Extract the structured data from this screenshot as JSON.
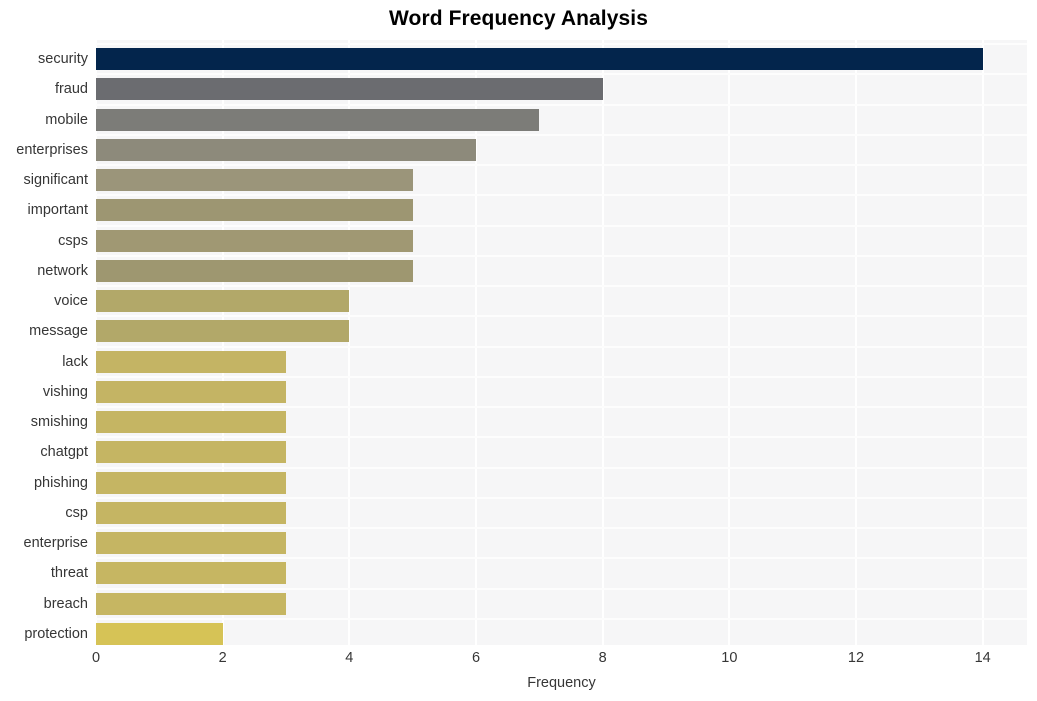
{
  "chart_data": {
    "type": "bar",
    "orientation": "horizontal",
    "title": "Word Frequency Analysis",
    "xlabel": "Frequency",
    "ylabel": "",
    "xlim": [
      0,
      14.7
    ],
    "xticks": [
      0,
      2,
      4,
      6,
      8,
      10,
      12,
      14
    ],
    "xticklabels": [
      "0",
      "2",
      "4",
      "6",
      "8",
      "10",
      "12",
      "14"
    ],
    "grid": true,
    "grid_axis": "x",
    "legend": false,
    "categories": [
      "security",
      "fraud",
      "mobile",
      "enterprises",
      "significant",
      "important",
      "csps",
      "network",
      "voice",
      "message",
      "lack",
      "vishing",
      "smishing",
      "chatgpt",
      "phishing",
      "csp",
      "enterprise",
      "threat",
      "breach",
      "protection"
    ],
    "values": [
      14,
      8,
      7,
      6,
      5,
      5,
      5,
      5,
      4,
      4,
      3,
      3,
      3,
      3,
      3,
      3,
      3,
      3,
      3,
      2
    ],
    "bar_colors": [
      "#03254c",
      "#6b6c70",
      "#7c7c78",
      "#8d8a7b",
      "#9b957a",
      "#9d9672",
      "#a09873",
      "#9e9770",
      "#b2a869",
      "#b2a869",
      "#c4b464",
      "#c4b464",
      "#c5b563",
      "#c5b563",
      "#c5b563",
      "#c5b563",
      "#c5b563",
      "#c6b662",
      "#c6b662",
      "#d6c356"
    ],
    "plot_background": "#f6f6f7",
    "grid_color": "#ffffff",
    "figure_background": "#ffffff",
    "text_color": "#363636",
    "title_color": "#000000"
  }
}
